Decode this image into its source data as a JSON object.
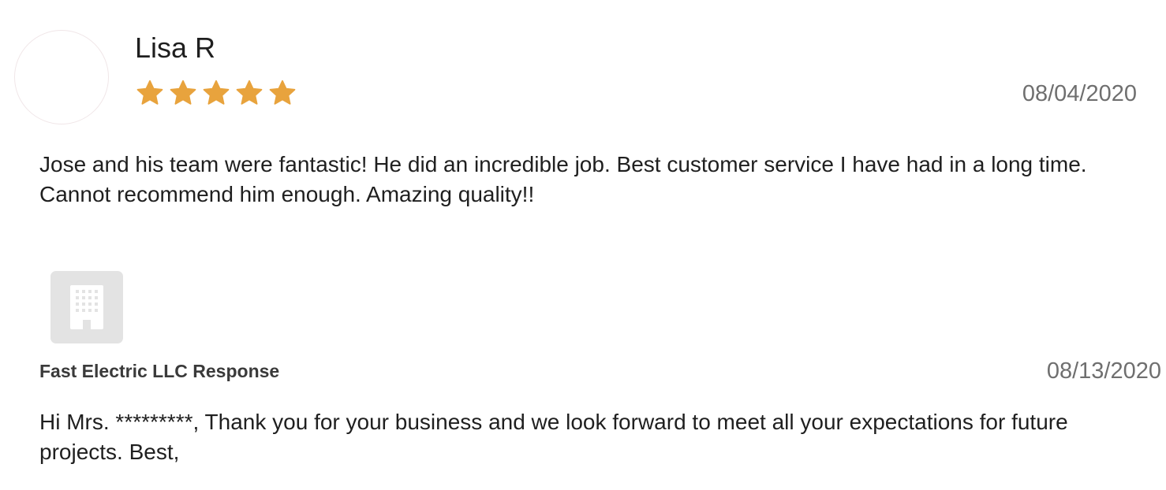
{
  "review": {
    "reviewer_name": "Lisa R",
    "rating": 5,
    "rating_max": 5,
    "star_color": "#E8A33D",
    "date": "08/04/2020",
    "text": "Jose and his team were fantastic! He did an incredible job. Best customer service I have had in a long time. Cannot recommend him enough. Amazing quality!!",
    "avatar_icon": "avatar-placeholder"
  },
  "response": {
    "logo_icon": "building-icon",
    "title": "Fast Electric LLC Response",
    "date": "08/13/2020",
    "text": "Hi Mrs. *********, Thank you for your business and we look forward to meet all your expectations for future projects. Best,"
  }
}
